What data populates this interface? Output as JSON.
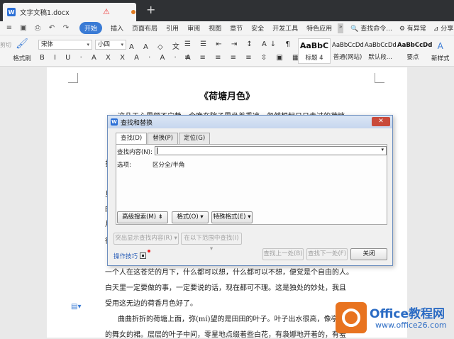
{
  "window": {
    "doc_tab": "文字文稿1.docx",
    "warn_icon": "warning-icon",
    "new_tab": "+"
  },
  "menu": {
    "items": [
      "开始",
      "插入",
      "页面布局",
      "引用",
      "审阅",
      "视图",
      "章节",
      "安全",
      "开发工具",
      "特色应用"
    ],
    "more": "»",
    "search": "查找命令...",
    "feedback": "有异常",
    "share": "分享"
  },
  "ribbon": {
    "cut": "剪切",
    "format_painter": "格式刷",
    "font": "宋体",
    "size": "小四",
    "styles": [
      {
        "sample": "AaBbC",
        "label": "标题 4"
      },
      {
        "sample": "AaBbCcDd",
        "label": "普通(网站)"
      },
      {
        "sample": "AaBbCcDd",
        "label": "默认段..."
      },
      {
        "sample": "AaBbCcDd",
        "label": "要点"
      }
    ],
    "new_style": "新样式"
  },
  "document": {
    "title": "《荷塘月色》",
    "line1": "这几天心里颇不宁静。今晚在院子里坐着乘凉，忽然想起日日走过的荷塘，",
    "margin_chars": [
      "扌",
      "旦",
      "时",
      "月",
      "徘"
    ],
    "line_a": "一个人在这苍茫的月下，什么都可以想，什么都可以不想，便觉是个自由的人。",
    "line_b": "白天里一定要做的事，一定要说的话，现在都可不理。这是独处的妙处，我且",
    "line_c": "受用这无边的荷香月色好了。",
    "line_d": "曲曲折折的荷塘上面，弥(mí)望的是田田的叶子。叶子出水很高，像亭亭",
    "line_e": "的舞女的裙。层层的叶子中间，零星地点缀着些白花，有袅娜地开着的，有羞"
  },
  "dialog": {
    "title": "查找和替换",
    "tabs": [
      "查找(D)",
      "替换(P)",
      "定位(G)"
    ],
    "find_label": "查找内容(N):",
    "find_value": "",
    "options_label": "选项:",
    "options_value": "区分全/半角",
    "adv_search": "高级搜索(M) ⇟",
    "format": "格式(O) ▾",
    "special": "特殊格式(E) ▾",
    "highlight": "突出显示查找内容(R) ▾",
    "in_range": "在以下范围中查找(I) ▾",
    "tips": "操作技巧",
    "find_prev": "查找上一处(B)",
    "find_next": "查找下一处(F)",
    "close": "关闭"
  },
  "watermark": {
    "brand": "Office教程网",
    "url": "www.office26.com"
  }
}
